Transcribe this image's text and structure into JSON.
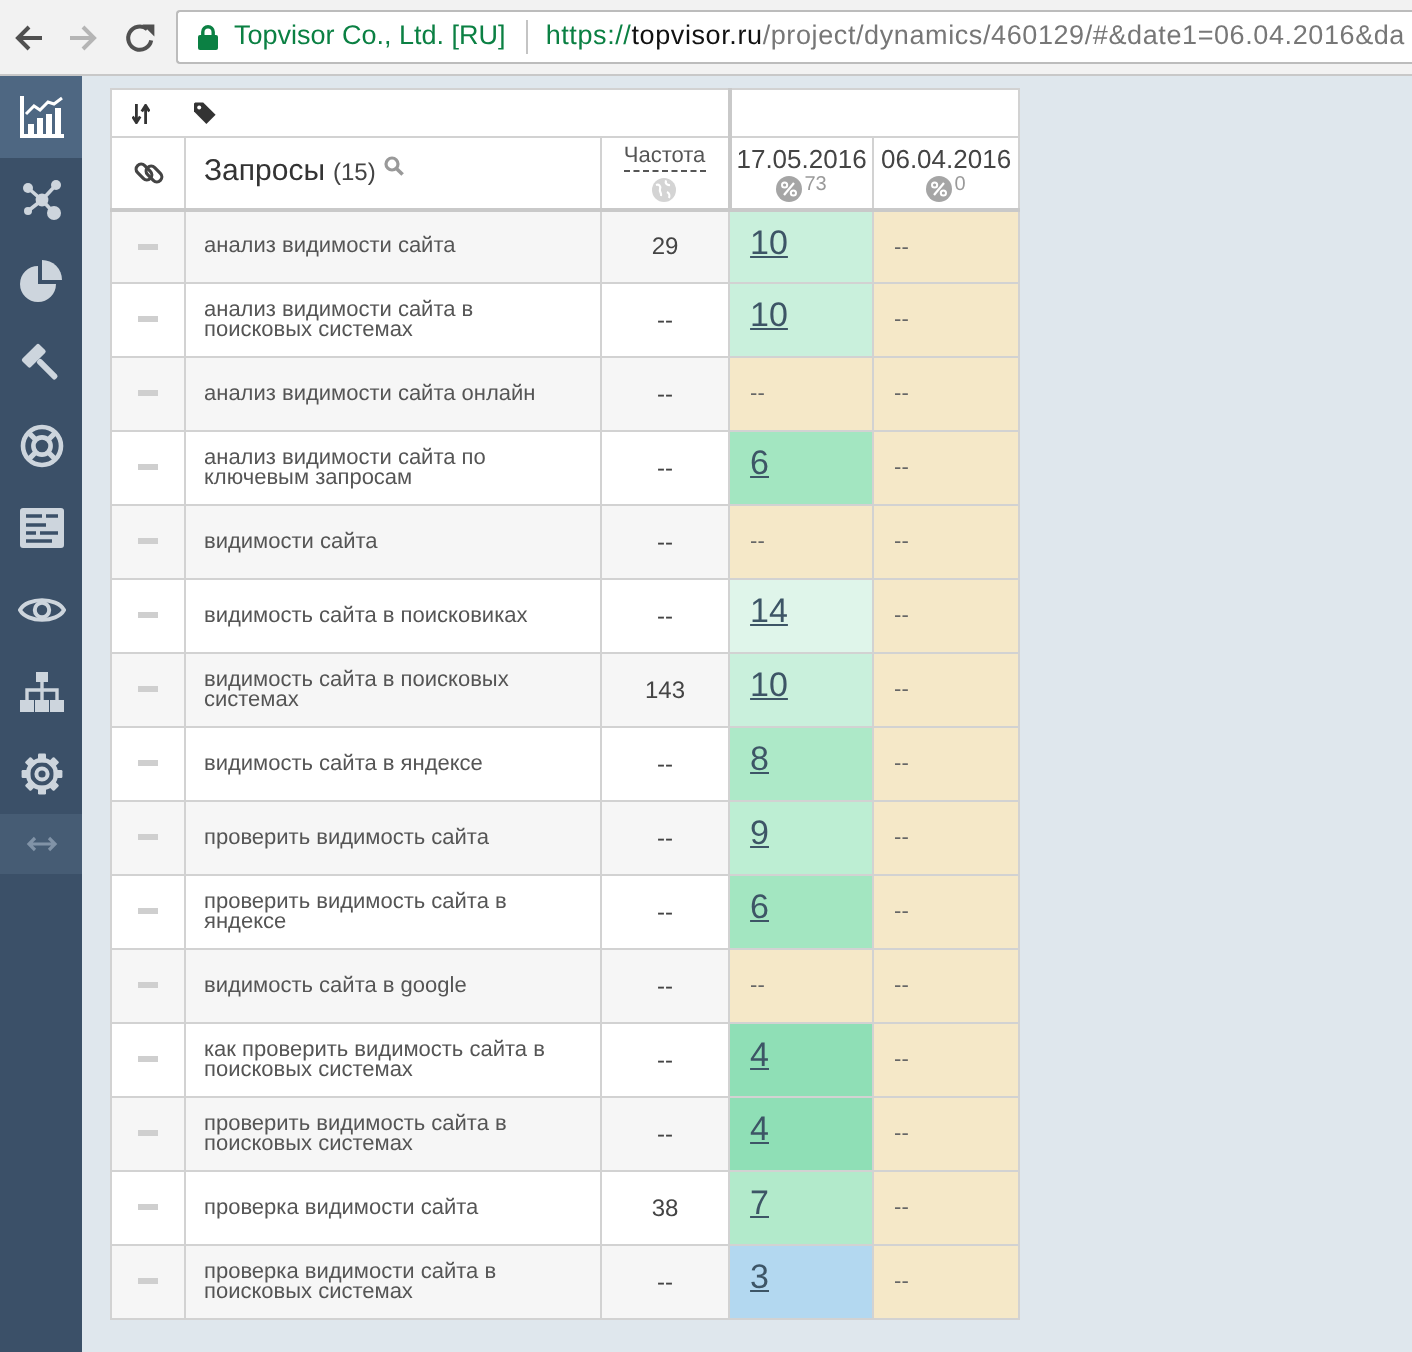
{
  "browser": {
    "back": {
      "disabled": false
    },
    "forward": {
      "disabled": true
    },
    "security_label": "Topvisor Co., Ltd. [RU]",
    "url_scheme": "https://",
    "url_host": "topvisor.ru",
    "url_path": "/project/dynamics/460129/#&date1=06.04.2016&da"
  },
  "sidebar": {
    "items": [
      {
        "selected": true
      },
      {
        "selected": false
      },
      {
        "selected": false
      },
      {
        "selected": false
      },
      {
        "selected": false
      },
      {
        "selected": false
      },
      {
        "selected": false
      },
      {
        "selected": false
      },
      {
        "selected": false
      }
    ]
  },
  "table": {
    "columns": [
      {
        "kind": "query",
        "title": "Запросы",
        "count": "(15)"
      },
      {
        "kind": "frequency",
        "title": "Частота"
      },
      {
        "kind": "date",
        "title": "17.05.2016",
        "score": "73"
      },
      {
        "kind": "date",
        "title": "06.04.2016",
        "score": "0"
      }
    ],
    "rows": [
      {
        "query": "анализ видимости сайта",
        "frequency": "29",
        "positions": [
          {
            "kind": "rank",
            "value": "10",
            "color": "#c9f0dc"
          },
          {
            "kind": "none",
            "value": "--",
            "color": "#f5e8c8"
          }
        ]
      },
      {
        "query": "анализ видимости сайта в поисковых системах",
        "frequency": "--",
        "positions": [
          {
            "kind": "rank",
            "value": "10",
            "color": "#c9f0dc"
          },
          {
            "kind": "none",
            "value": "--",
            "color": "#f5e8c8"
          }
        ]
      },
      {
        "query": "анализ видимости сайта онлайн",
        "frequency": "--",
        "positions": [
          {
            "kind": "none",
            "value": "--",
            "color": "#f5e8c8"
          },
          {
            "kind": "none",
            "value": "--",
            "color": "#f5e8c8"
          }
        ]
      },
      {
        "query": "анализ видимости сайта по ключевым запросам",
        "frequency": "--",
        "positions": [
          {
            "kind": "rank",
            "value": "6",
            "color": "#a3e6c1"
          },
          {
            "kind": "none",
            "value": "--",
            "color": "#f5e8c8"
          }
        ]
      },
      {
        "query": "видимости сайта",
        "frequency": "--",
        "positions": [
          {
            "kind": "none",
            "value": "--",
            "color": "#f5e8c8"
          },
          {
            "kind": "none",
            "value": "--",
            "color": "#f5e8c8"
          }
        ]
      },
      {
        "query": "видимость сайта в поисковиках",
        "frequency": "--",
        "positions": [
          {
            "kind": "rank",
            "value": "14",
            "color": "#dff5ea"
          },
          {
            "kind": "none",
            "value": "--",
            "color": "#f5e8c8"
          }
        ]
      },
      {
        "query": "видимость сайта в поисковых системах",
        "frequency": "143",
        "positions": [
          {
            "kind": "rank",
            "value": "10",
            "color": "#c9f0dc"
          },
          {
            "kind": "none",
            "value": "--",
            "color": "#f5e8c8"
          }
        ]
      },
      {
        "query": "видимость сайта в яндексе",
        "frequency": "--",
        "positions": [
          {
            "kind": "rank",
            "value": "8",
            "color": "#ade9c8"
          },
          {
            "kind": "none",
            "value": "--",
            "color": "#f5e8c8"
          }
        ]
      },
      {
        "query": "проверить видимость сайта",
        "frequency": "--",
        "positions": [
          {
            "kind": "rank",
            "value": "9",
            "color": "#bdeed3"
          },
          {
            "kind": "none",
            "value": "--",
            "color": "#f5e8c8"
          }
        ]
      },
      {
        "query": "проверить видимость сайта в яндексе",
        "frequency": "--",
        "positions": [
          {
            "kind": "rank",
            "value": "6",
            "color": "#a3e6c1"
          },
          {
            "kind": "none",
            "value": "--",
            "color": "#f5e8c8"
          }
        ]
      },
      {
        "query": "видимость сайта в google",
        "frequency": "--",
        "positions": [
          {
            "kind": "none",
            "value": "--",
            "color": "#f5e8c8"
          },
          {
            "kind": "none",
            "value": "--",
            "color": "#f5e8c8"
          }
        ]
      },
      {
        "query": "как проверить видимость сайта в поисковых системах",
        "frequency": "--",
        "positions": [
          {
            "kind": "rank",
            "value": "4",
            "color": "#8fdfb6"
          },
          {
            "kind": "none",
            "value": "--",
            "color": "#f5e8c8"
          }
        ]
      },
      {
        "query": "проверить видимость сайта в поисковых системах",
        "frequency": "--",
        "positions": [
          {
            "kind": "rank",
            "value": "4",
            "color": "#8fdfb6"
          },
          {
            "kind": "none",
            "value": "--",
            "color": "#f5e8c8"
          }
        ]
      },
      {
        "query": "проверка видимости сайта",
        "frequency": "38",
        "positions": [
          {
            "kind": "rank",
            "value": "7",
            "color": "#b2eacb"
          },
          {
            "kind": "none",
            "value": "--",
            "color": "#f5e8c8"
          }
        ]
      },
      {
        "query": "проверка видимости сайта в поисковых системах",
        "frequency": "--",
        "positions": [
          {
            "kind": "rank",
            "value": "3",
            "color": "#b3d8f0"
          },
          {
            "kind": "none",
            "value": "--",
            "color": "#f5e8c8"
          }
        ]
      }
    ]
  }
}
